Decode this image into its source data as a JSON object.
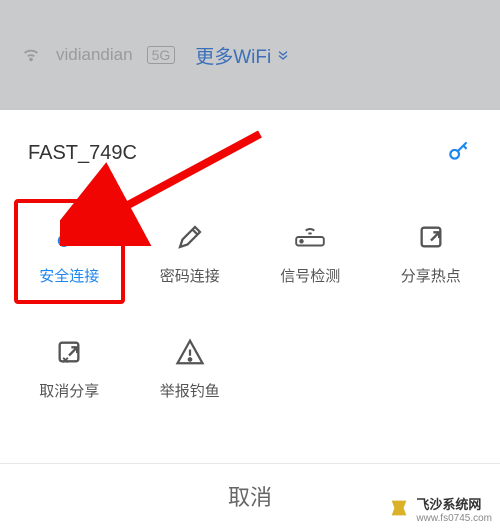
{
  "background": {
    "ssid": "vidiandian",
    "badge": "5G",
    "more_label": "更多WiFi"
  },
  "sheet": {
    "title": "FAST_749C"
  },
  "options": [
    {
      "key": "secure-connect",
      "label": "安全连接",
      "icon": "key-icon",
      "active": true,
      "highlighted": true
    },
    {
      "key": "password-connect",
      "label": "密码连接",
      "icon": "pencil-icon",
      "active": false,
      "highlighted": false
    },
    {
      "key": "signal-detect",
      "label": "信号检测",
      "icon": "router-icon",
      "active": false,
      "highlighted": false
    },
    {
      "key": "share-hotspot",
      "label": "分享热点",
      "icon": "share-out-icon",
      "active": false,
      "highlighted": false
    },
    {
      "key": "cancel-share",
      "label": "取消分享",
      "icon": "share-x-icon",
      "active": false,
      "highlighted": false
    },
    {
      "key": "report-phishing",
      "label": "举报钓鱼",
      "icon": "alert-icon",
      "active": false,
      "highlighted": false
    }
  ],
  "footer": {
    "cancel_label": "取消"
  },
  "watermark": {
    "title": "飞沙系统网",
    "sub": "www.fs0745.com"
  },
  "colors": {
    "accent": "#1e87f0",
    "highlight_border": "#f00502"
  }
}
